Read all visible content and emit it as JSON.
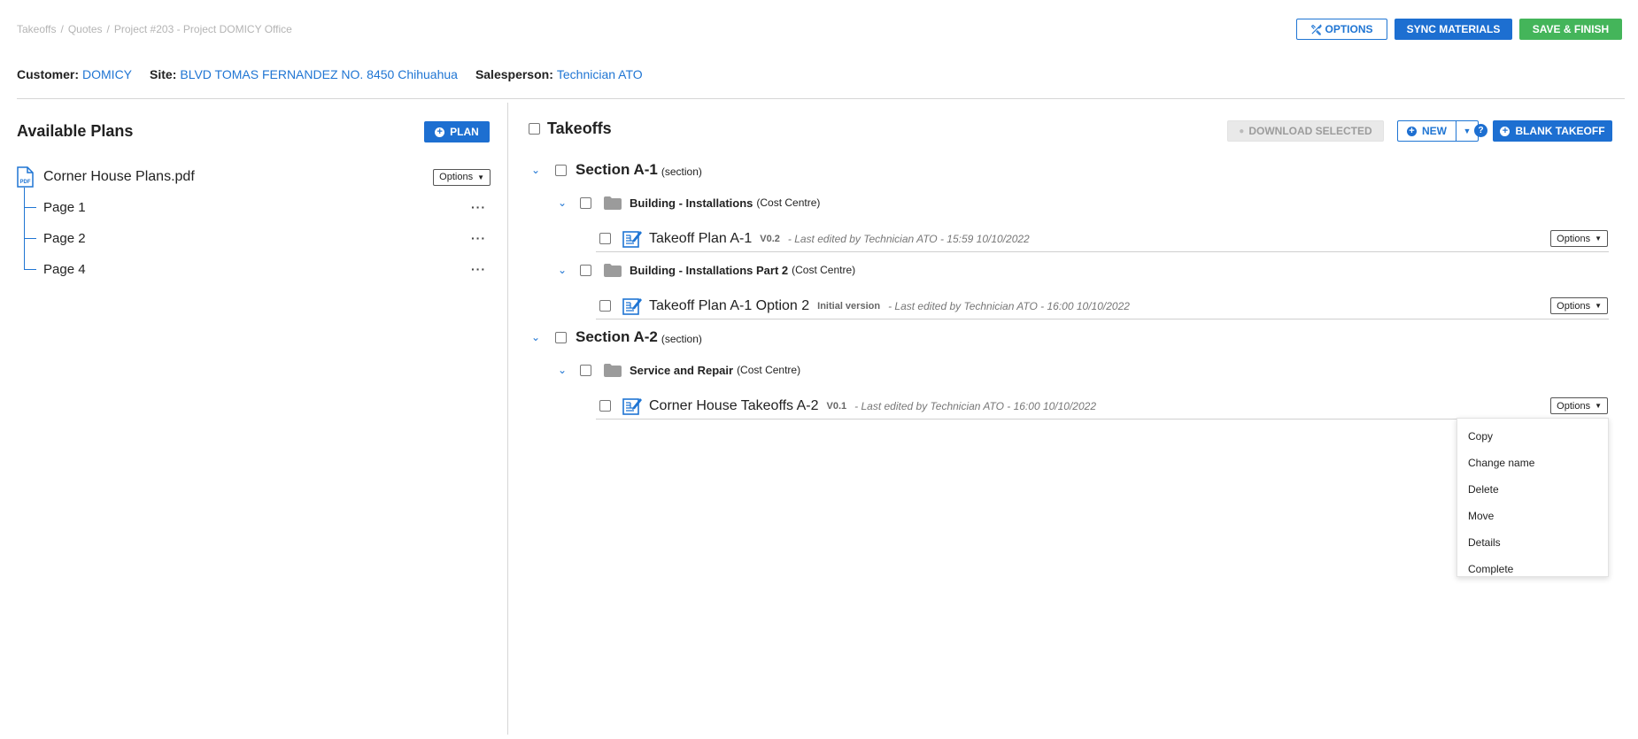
{
  "breadcrumb": [
    "Takeoffs",
    "Quotes",
    "Project #203 - Project DOMICY Office"
  ],
  "header": {
    "options_label": "OPTIONS",
    "sync_label": "SYNC MATERIALS",
    "save_label": "SAVE & FINISH"
  },
  "info": {
    "customer_label": "Customer:",
    "customer": "DOMICY",
    "site_label": "Site:",
    "site": "BLVD TOMAS FERNANDEZ NO. 8450 Chihuahua",
    "salesperson_label": "Salesperson:",
    "salesperson": "Technician ATO"
  },
  "plans": {
    "title": "Available Plans",
    "add_label": "PLAN",
    "file_name": "Corner House Plans.pdf",
    "file_icon": "pdf-file-icon",
    "options_label": "Options",
    "pages": [
      "Page 1",
      "Page 2",
      "Page 4"
    ]
  },
  "takeoffs": {
    "title": "Takeoffs",
    "download_label": "DOWNLOAD SELECTED",
    "new_label": "NEW",
    "help_label": "?",
    "blank_label": "BLANK TAKEOFF",
    "options_label": "Options",
    "sections": [
      {
        "name": "Section A-1",
        "type": "(section)",
        "cost_centres": [
          {
            "name": "Building - Installations",
            "type": "(Cost Centre)",
            "items": [
              {
                "name": "Takeoff Plan A-1",
                "version": "V0.2",
                "meta": "- Last edited by Technician ATO - 15:59  10/10/2022"
              }
            ]
          },
          {
            "name": "Building - Installations Part 2",
            "type": "(Cost Centre)",
            "items": [
              {
                "name": "Takeoff Plan A-1 Option 2",
                "version": "Initial version",
                "meta": "- Last edited by Technician ATO - 16:00  10/10/2022"
              }
            ]
          }
        ]
      },
      {
        "name": "Section A-2",
        "type": "(section)",
        "cost_centres": [
          {
            "name": "Service and Repair",
            "type": "(Cost Centre)",
            "items": [
              {
                "name": "Corner House Takeoffs A-2",
                "version": "V0.1",
                "meta": "- Last edited by Technician ATO - 16:00  10/10/2022"
              }
            ]
          }
        ]
      }
    ]
  },
  "menu": [
    "Copy",
    "Change name",
    "Delete",
    "Move",
    "Details",
    "Complete"
  ],
  "colors": {
    "accent": "#1d6fd1",
    "success": "#44b55a",
    "link": "#1f75d3"
  }
}
